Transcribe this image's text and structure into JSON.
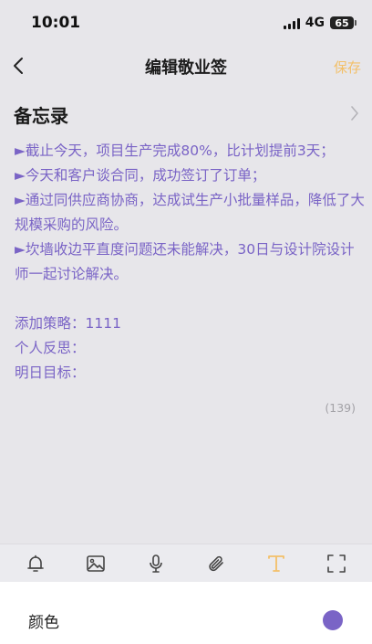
{
  "status_bar": {
    "time": "10:01",
    "network": "4G",
    "battery": "65"
  },
  "nav": {
    "title": "编辑敬业签",
    "save_label": "保存"
  },
  "category": {
    "label": "备忘录"
  },
  "note": {
    "text_color": "#7a64c6",
    "lines": [
      "►截止今天，项目生产完成80%，比计划提前3天；",
      "►今天和客户谈合同，成功签订了订单；",
      "►通过同供应商协商，达成试生产小批量样品，降低了大规模采购的风险。",
      "►坎墙收边平直度问题还未能解决，30日与设计院设计师一起讨论解决。"
    ],
    "fields": [
      "添加策略：1111",
      "个人反思：",
      "明日目标："
    ],
    "char_count": "(139)"
  },
  "toolbar": {
    "accent_color": "#f3c069",
    "items": [
      "bell-icon",
      "image-icon",
      "microphone-icon",
      "paperclip-icon",
      "text-format-icon",
      "fullscreen-icon"
    ]
  },
  "color_panel": {
    "label": "颜色",
    "selected_color": "#7a64c6"
  }
}
